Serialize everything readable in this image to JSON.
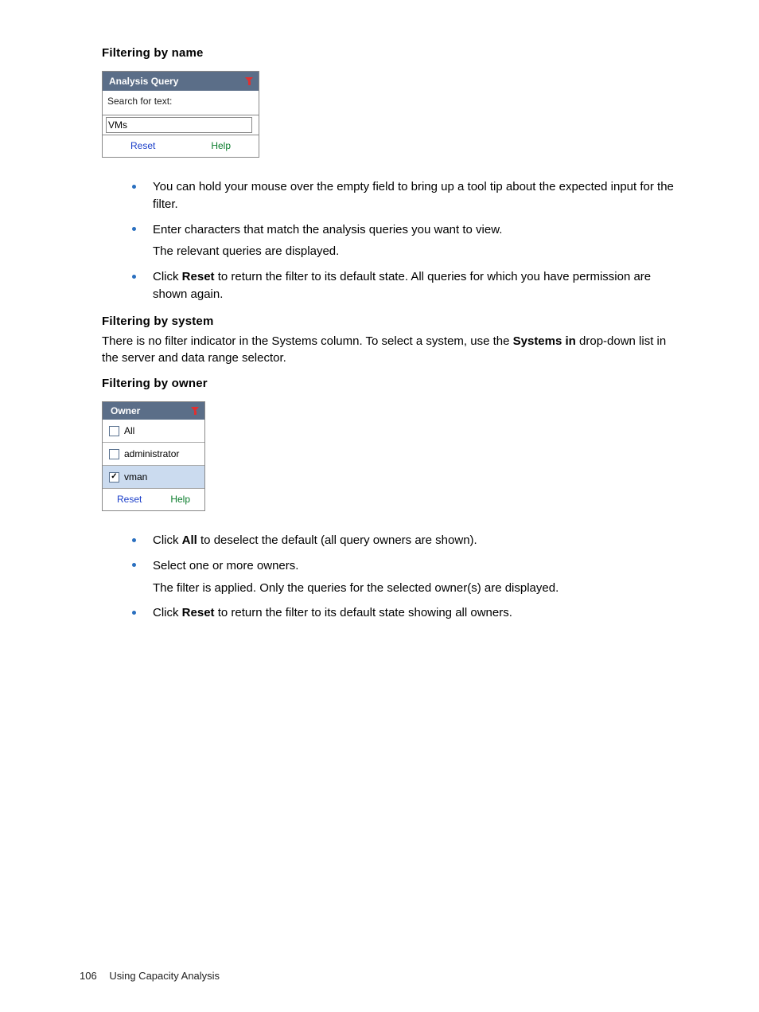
{
  "sections": {
    "filter_by_name_title": "Filtering by name",
    "filter_by_system_title": "Filtering by system",
    "filter_by_owner_title": "Filtering by owner",
    "filter_by_system_para_pre": "There is no filter indicator in the Systems column. To select a system, use the ",
    "filter_by_system_bold": "Systems in",
    "filter_by_system_para_post": " drop-down list in the server and data range selector."
  },
  "analysis_query_panel": {
    "title": "Analysis Query",
    "search_label": "Search for text:",
    "input_value": "VMs",
    "reset_label": "Reset",
    "help_label": "Help"
  },
  "name_bullets": {
    "b1": "You can hold your mouse over the empty field to bring up a tool tip about the expected input for the filter.",
    "b2": "Enter characters that match the analysis queries you want to view.",
    "b2_sub": "The relevant queries are displayed.",
    "b3_pre": "Click ",
    "b3_bold": "Reset",
    "b3_post": " to return the filter to its default state. All queries for which you have permission are shown again."
  },
  "owner_panel": {
    "title": "Owner",
    "items": [
      {
        "label": "All",
        "checked": false,
        "selected": false
      },
      {
        "label": "administrator",
        "checked": false,
        "selected": false
      },
      {
        "label": "vman",
        "checked": true,
        "selected": true
      }
    ],
    "reset_label": "Reset",
    "help_label": "Help"
  },
  "owner_bullets": {
    "b1_pre": "Click ",
    "b1_bold": "All",
    "b1_post": " to deselect the default (all query owners are shown).",
    "b2": "Select one or more owners.",
    "b2_sub": "The filter is applied. Only the queries for the selected owner(s) are displayed.",
    "b3_pre": "Click ",
    "b3_bold": "Reset",
    "b3_post": " to return the filter to its default state showing all owners."
  },
  "footer": {
    "page_number": "106",
    "chapter": "Using Capacity Analysis"
  }
}
